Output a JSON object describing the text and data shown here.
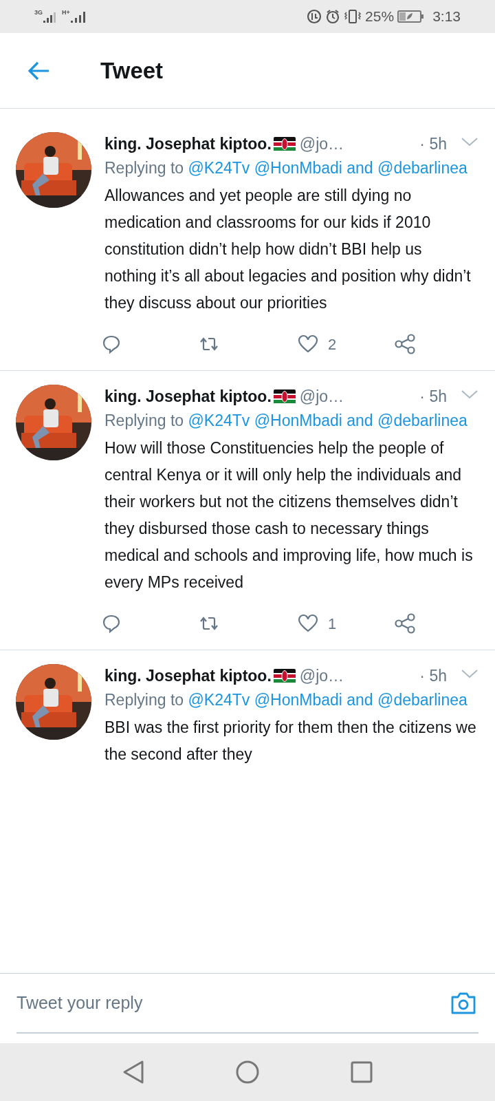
{
  "status_bar": {
    "network_1": "3G",
    "network_2": "H+",
    "battery": "25%",
    "time": "3:13"
  },
  "header": {
    "title": "Tweet"
  },
  "tweets": [
    {
      "name": "king. Josephat kiptoo.",
      "handle": "@jo…",
      "time": "· 5h",
      "reply_prefix": "Replying to",
      "mentions": [
        "@K24Tv",
        "@HonMbadi"
      ],
      "connector": "and",
      "last_mention": "@debarlinea",
      "body": "Allowances and yet people are still dying no medication and classrooms for our kids if 2010 constitution didn’t help how didn’t BBI help us nothing it’s all about legacies and position why didn’t they discuss about our priorities",
      "likes": "2"
    },
    {
      "name": "king. Josephat kiptoo.",
      "handle": "@jo…",
      "time": "· 5h",
      "reply_prefix": "Replying to",
      "mentions": [
        "@K24Tv",
        "@HonMbadi"
      ],
      "connector": "and",
      "last_mention": "@debarlinea",
      "body": "How will those Constituencies help the people of central Kenya or it will only help the individuals and their workers but not the citizens themselves didn’t they disbursed those cash to necessary things medical and schools and improving life, how much is every MPs received",
      "likes": "1"
    },
    {
      "name": "king. Josephat kiptoo.",
      "handle": "@jo…",
      "time": "· 5h",
      "reply_prefix": "Replying to",
      "mentions": [
        "@K24Tv",
        "@HonMbadi"
      ],
      "connector": "and",
      "last_mention": "@debarlinea",
      "body": "BBI was the first priority for them then the citizens we the second after they"
    }
  ],
  "reply_bar": {
    "placeholder": "Tweet your reply"
  }
}
